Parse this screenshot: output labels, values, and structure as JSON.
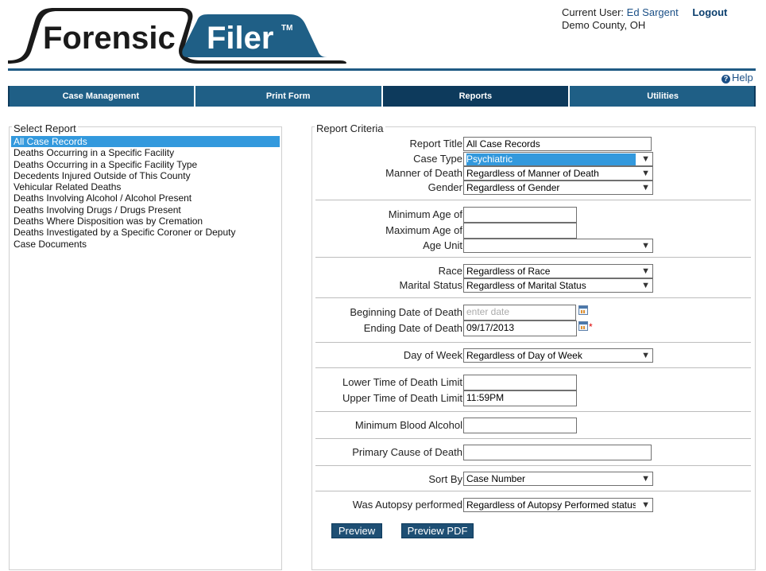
{
  "app": {
    "logo_text_left": "Forensic",
    "logo_text_right": "Filer",
    "logo_tm": "TM"
  },
  "user": {
    "label": "Current User:",
    "name": "Ed Sargent",
    "logout": "Logout",
    "county": "Demo County, OH"
  },
  "help": "Help",
  "nav": {
    "tabs": [
      {
        "label": "Case Management"
      },
      {
        "label": "Print Form"
      },
      {
        "label": "Reports",
        "active": true
      },
      {
        "label": "Utilities"
      }
    ]
  },
  "select_report": {
    "legend": "Select Report",
    "items": [
      "All Case Records",
      "Deaths Occurring in a Specific Facility",
      "Deaths Occurring in a Specific Facility Type",
      "Decedents Injured Outside of This County",
      "Vehicular Related Deaths",
      "Deaths Involving Alcohol / Alcohol Present",
      "Deaths Involving Drugs / Drugs Present",
      "Deaths Where Disposition was by Cremation",
      "Deaths Investigated by a Specific Coroner or Deputy",
      "Case Documents"
    ],
    "selected_index": 0
  },
  "criteria": {
    "legend": "Report Criteria",
    "report_title": {
      "label": "Report Title",
      "value": "All Case Records"
    },
    "case_type": {
      "label": "Case Type",
      "value": "Psychiatric"
    },
    "manner_of_death": {
      "label": "Manner of Death",
      "value": "Regardless of Manner of Death"
    },
    "gender": {
      "label": "Gender",
      "value": "Regardless of Gender"
    },
    "min_age": {
      "label": "Minimum Age of",
      "value": ""
    },
    "max_age": {
      "label": "Maximum Age of",
      "value": ""
    },
    "age_unit": {
      "label": "Age Unit",
      "value": ""
    },
    "race": {
      "label": "Race",
      "value": "Regardless of Race"
    },
    "marital_status": {
      "label": "Marital Status",
      "value": "Regardless of Marital Status"
    },
    "begin_date": {
      "label": "Beginning Date of Death",
      "placeholder": "enter date"
    },
    "end_date": {
      "label": "Ending Date of Death",
      "value": "09/17/2013",
      "required_mark": "*"
    },
    "day_of_week": {
      "label": "Day of Week",
      "value": "Regardless of Day of Week"
    },
    "lower_time": {
      "label": "Lower Time of Death Limit",
      "value": ""
    },
    "upper_time": {
      "label": "Upper Time of Death Limit",
      "value": "11:59PM"
    },
    "min_blood_alcohol": {
      "label": "Minimum Blood Alcohol",
      "value": ""
    },
    "primary_cause": {
      "label": "Primary Cause of Death",
      "value": ""
    },
    "sort_by": {
      "label": "Sort By",
      "value": "Case Number"
    },
    "autopsy": {
      "label": "Was Autopsy performed",
      "value": "Regardless of Autopsy Performed status"
    }
  },
  "buttons": {
    "preview": "Preview",
    "preview_pdf": "Preview PDF"
  },
  "colors": {
    "brand": "#1f5f86",
    "nav_active": "#0d3a5c",
    "selection": "#3399dd"
  }
}
